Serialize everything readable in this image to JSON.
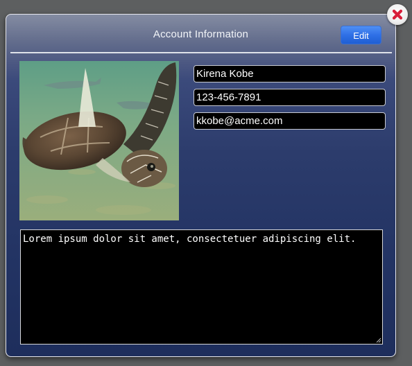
{
  "dialog": {
    "title": "Account Information",
    "edit_label": "Edit"
  },
  "profile": {
    "photo_icon": "sea-turtle-photo",
    "name": "Kirena Kobe",
    "phone": "123-456-7891",
    "email": "kkobe@acme.com"
  },
  "notes": {
    "text": "Lorem ipsum dolor sit amet, consectetuer adipiscing elit."
  },
  "icons": {
    "close": "close-icon"
  },
  "colors": {
    "background": "#5d5f60",
    "dialog_top": "#848ca2",
    "dialog_bottom": "#1e2e5c",
    "button_blue": "#2f70e6",
    "close_x": "#d81e3a"
  }
}
